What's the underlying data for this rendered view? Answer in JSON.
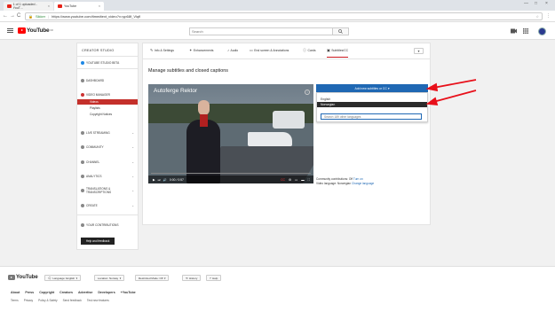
{
  "browser": {
    "tabs": [
      {
        "label": "1 of 1 uploaded - YouT…",
        "close": "×"
      },
      {
        "label": "YouTube",
        "close": "×"
      }
    ],
    "window_controls": [
      "—",
      "□",
      "×"
    ],
    "nav": [
      "←",
      "→",
      "C"
    ],
    "secure_label": "Sikker",
    "url": "https://www.youtube.com/timedtext_video?v=yp68f_Vlqfl",
    "star": "☆",
    "menu": "⋮"
  },
  "youtube_header": {
    "logo_text": "YouTube",
    "logo_sup": "NO",
    "search_placeholder": "Search",
    "search_icon": "search-icon"
  },
  "sidebar": {
    "title": "CREATOR STUDIO",
    "items": [
      {
        "label": "YOUTUBE STUDIO BETA",
        "icon": "studio-icon"
      },
      {
        "label": "DASHBOARD",
        "icon": "dashboard-icon"
      },
      {
        "label": "VIDEO MANAGER",
        "icon": "video-manager-icon"
      },
      {
        "label": "LIVE STREAMING",
        "icon": "live-icon",
        "chevron": "⌄"
      },
      {
        "label": "COMMUNITY",
        "icon": "community-icon",
        "chevron": "⌄"
      },
      {
        "label": "CHANNEL",
        "icon": "channel-icon",
        "chevron": "⌄"
      },
      {
        "label": "ANALYTICS",
        "icon": "analytics-icon",
        "chevron": "⌄"
      },
      {
        "label": "TRANSLATIONS & TRANSCRIPTIONS",
        "icon": "translations-icon",
        "chevron": "⌄"
      },
      {
        "label": "CREATE",
        "icon": "create-icon",
        "chevron": "⌄"
      },
      {
        "label": "YOUR CONTRIBUTIONS",
        "icon": "contributions-icon"
      }
    ],
    "sub_items": [
      "Videos",
      "Playlists",
      "Copyright Notices"
    ],
    "help_button": "Help and feedback"
  },
  "editor": {
    "tabs": [
      {
        "label": "Info & Settings",
        "icon": "✎"
      },
      {
        "label": "Enhancements",
        "icon": "✦"
      },
      {
        "label": "Audio",
        "icon": "♪"
      },
      {
        "label": "End screen & Annotations",
        "icon": "▭"
      },
      {
        "label": "Cards",
        "icon": "ⓘ"
      },
      {
        "label": "Subtitles/CC",
        "icon": "▣"
      }
    ],
    "more_button": "▾",
    "page_title": "Manage subtitles and closed captions"
  },
  "video": {
    "title": "Autoferge Rektor",
    "info": "i",
    "time": "0:00 / 0:57",
    "play": "▶",
    "next": "⏭",
    "volume": "🔊",
    "cc": "CC",
    "settings": "⚙",
    "mini": "▭",
    "theater": "▬",
    "fullscreen": "⛶"
  },
  "subtitles": {
    "add_button": "Add new subtitles or CC",
    "add_caret": "▾",
    "options": [
      "English",
      "Norwegian"
    ],
    "selected_option": "Norwegian",
    "search_placeholder": "Search 189 other languages",
    "community_label": "Community contributions: Off",
    "community_link": "Turn on",
    "language_label": "Video language: Norwegian",
    "language_link": "Change language"
  },
  "footer": {
    "logo_text": "YouTube",
    "buttons": [
      {
        "label": "Language: English",
        "icon": "🗨",
        "caret": "▾"
      },
      {
        "label": "Location: Norway",
        "caret": "▾"
      },
      {
        "label": "Restricted Mode: Off",
        "caret": "▾"
      },
      {
        "label": "History",
        "icon": "⟲"
      },
      {
        "label": "Help",
        "icon": "?"
      }
    ],
    "links_primary": [
      "About",
      "Press",
      "Copyright",
      "Creators",
      "Advertise",
      "Developers",
      "+YouTube"
    ],
    "links_secondary": [
      "Terms",
      "Privacy",
      "Policy & Safety",
      "Send feedback",
      "Test new features"
    ]
  },
  "colors": {
    "accent_red": "#cc181e",
    "button_blue": "#1f68b4",
    "annotation_arrow": "#e8101a"
  }
}
